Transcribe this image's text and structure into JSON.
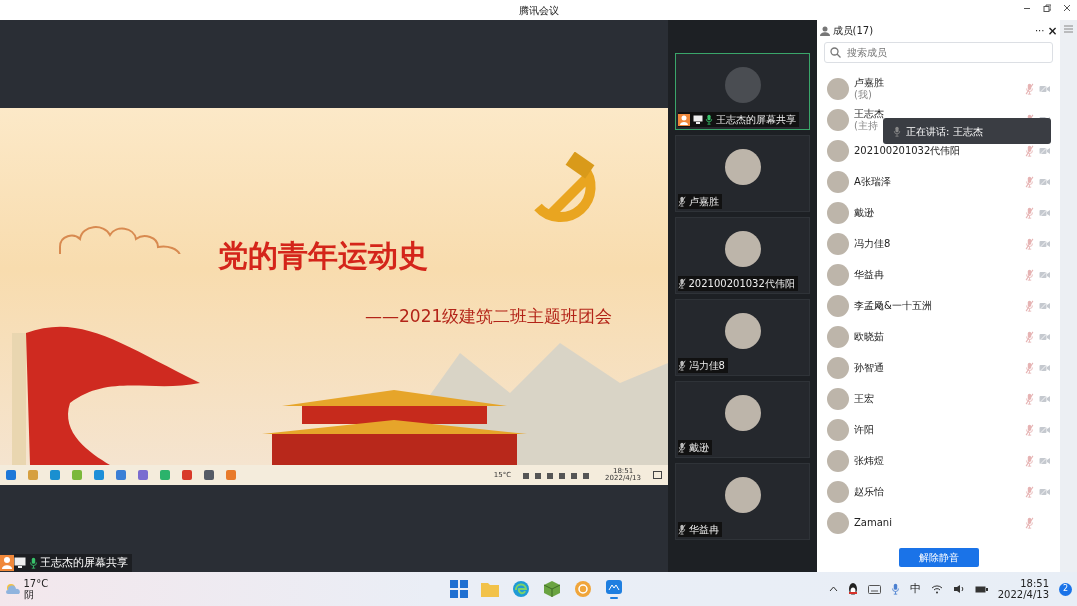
{
  "window": {
    "title": "腾讯会议"
  },
  "share": {
    "slide": {
      "title": "党的青年运动史",
      "subtitle": "——2021级建筑二班主题班团会"
    },
    "inner_taskbar": {
      "temperature": "15°C",
      "time": "18:51",
      "date": "2022/4/13"
    },
    "label": "王志杰的屏幕共享"
  },
  "video_tiles": [
    {
      "kind": "screen_share",
      "name": "王志杰的屏幕共享",
      "selected": true,
      "muted": false
    },
    {
      "kind": "member",
      "name": "卢嘉胜",
      "selected": false,
      "muted": true
    },
    {
      "kind": "member",
      "name": "202100201032代伟阳",
      "selected": false,
      "muted": true
    },
    {
      "kind": "member",
      "name": "冯力佳8",
      "selected": false,
      "muted": true
    },
    {
      "kind": "member",
      "name": "戴逊",
      "selected": false,
      "muted": true
    },
    {
      "kind": "member",
      "name": "华益冉",
      "selected": false,
      "muted": true
    }
  ],
  "members_panel": {
    "title": "成员(17)",
    "more": "···",
    "close": "×",
    "search": {
      "placeholder": "搜索成员"
    },
    "members": [
      {
        "name": "卢嘉胜",
        "note": "(我)",
        "muted": true,
        "video_off": true
      },
      {
        "name": "王志杰",
        "note": "(主持",
        "muted": true,
        "video_off": true
      },
      {
        "name": "202100201032代伟阳",
        "muted": true,
        "video_off": true
      },
      {
        "name": "A张瑞泽",
        "muted": true,
        "video_off": true
      },
      {
        "name": "戴逊",
        "muted": true,
        "video_off": true
      },
      {
        "name": "冯力佳8",
        "muted": true,
        "video_off": true
      },
      {
        "name": "华益冉",
        "muted": true,
        "video_off": true
      },
      {
        "name": "李孟飏&一十五洲",
        "muted": true,
        "video_off": true
      },
      {
        "name": "欧晓茹",
        "muted": true,
        "video_off": true
      },
      {
        "name": "孙智通",
        "muted": true,
        "video_off": true
      },
      {
        "name": "王宏",
        "muted": true,
        "video_off": true
      },
      {
        "name": "许阳",
        "muted": true,
        "video_off": true
      },
      {
        "name": "张炜煜",
        "muted": true,
        "video_off": true
      },
      {
        "name": "赵乐怡",
        "muted": true,
        "video_off": true
      },
      {
        "name": "Zamani",
        "muted": true
      }
    ],
    "tooltip": "正在讲话: 王志杰",
    "unmute_button": "解除静音"
  },
  "taskbar": {
    "weather": {
      "temperature": "17°C",
      "condition": "阴"
    },
    "ime": "中",
    "time": "18:51",
    "date": "2022/4/13",
    "notifications": "2"
  }
}
